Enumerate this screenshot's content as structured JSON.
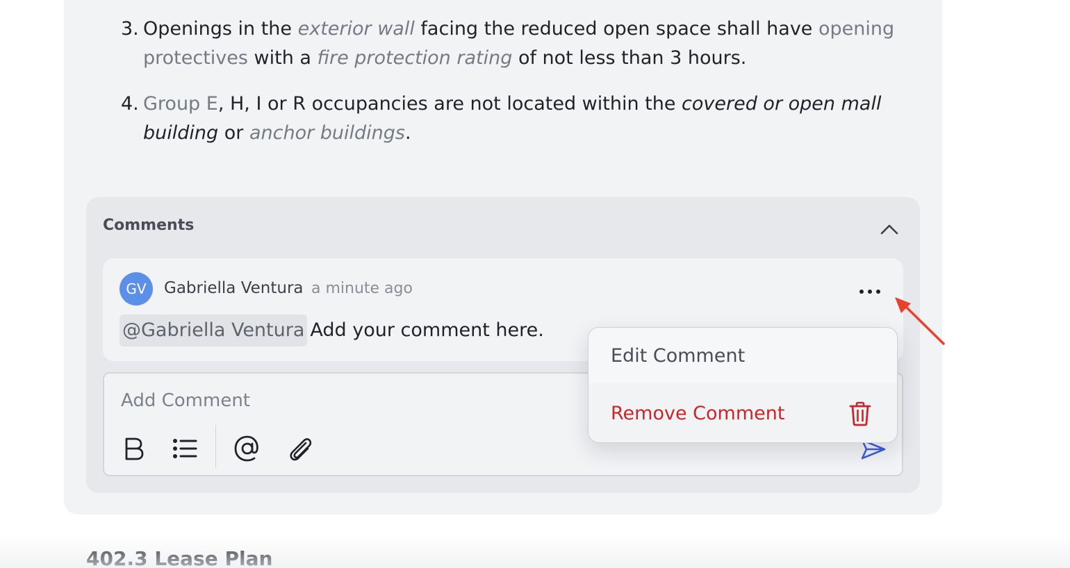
{
  "list_items": [
    {
      "number": "3.",
      "p1": "Openings in the ",
      "t1": "exterior wall",
      "p2": " facing the reduced open space shall have ",
      "t2": "opening protectives",
      "p3": " with a ",
      "t3": "fire protection rating",
      "p4": " of not less than 3 hours."
    },
    {
      "number": "4.",
      "t1": "Group E",
      "p1": ", H, I or R occupancies are not located within the ",
      "t2": "covered or open mall building",
      "p2": " or ",
      "t3": "anchor buildings",
      "p3": "."
    }
  ],
  "comments": {
    "title": "Comments",
    "collapse_icon": "chevron-up-icon",
    "items": [
      {
        "avatar_initials": "GV",
        "avatar_color": "#5b8fe8",
        "author": "Gabriella Ventura",
        "timestamp": "a minute ago",
        "mention": "@Gabriella Ventura",
        "text": "Add your comment here.",
        "menu_icon": "more-horizontal-icon"
      }
    ],
    "editor": {
      "placeholder": "Add Comment",
      "value": "",
      "toolbar": [
        "bold-icon",
        "bullet-list-icon",
        "mention-at-icon",
        "paperclip-icon"
      ],
      "send_icon": "send-icon",
      "send_color": "#3b5fd9"
    }
  },
  "context_menu": {
    "items": [
      {
        "label": "Edit Comment",
        "color": "#4a4d55"
      },
      {
        "label": "Remove Comment",
        "color": "#c8262b",
        "icon": "trash-icon"
      }
    ]
  },
  "annotation": {
    "type": "arrow",
    "color": "#e8412c"
  },
  "next_section": {
    "heading": "402.3 Lease Plan"
  }
}
